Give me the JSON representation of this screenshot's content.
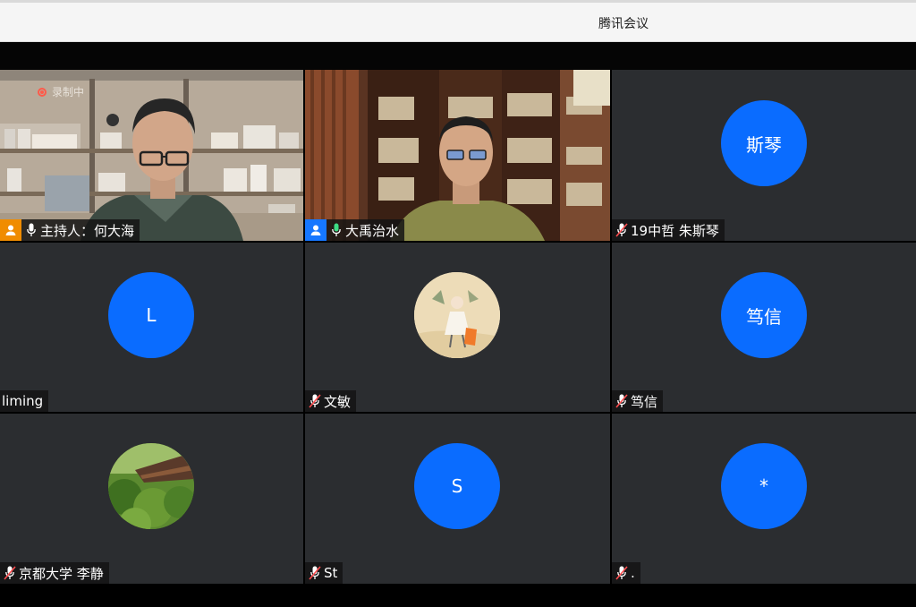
{
  "window": {
    "title": "腾讯会议"
  },
  "recording": {
    "label": "录制中"
  },
  "colors": {
    "avatar_blue": "#0a6cff",
    "host_orange": "#f08c00",
    "cohost_blue": "#1677ff",
    "active_green": "#2ea043"
  },
  "participants": [
    {
      "name": "主持人：何大海",
      "role": "host",
      "mic": "on",
      "video": true
    },
    {
      "name": "大禹治水",
      "role": "cohost",
      "mic": "on",
      "video": true,
      "speaking": true
    },
    {
      "name": "19中哲 朱斯琴",
      "avatar_text": "斯琴",
      "mic": "muted",
      "video": false
    },
    {
      "name": "liming",
      "avatar_text": "L",
      "mic": "none",
      "video": false
    },
    {
      "name": "文敏",
      "avatar_icon": "illustration-avatar-icon",
      "mic": "muted",
      "video": false
    },
    {
      "name": "笃信",
      "avatar_text": "笃信",
      "mic": "muted",
      "video": false
    },
    {
      "name": "京都大学 李静",
      "avatar_icon": "pagoda-photo-avatar-icon",
      "mic": "muted",
      "video": false
    },
    {
      "name": "St",
      "avatar_text": "S",
      "mic": "muted",
      "video": false
    },
    {
      "name": ".",
      "avatar_text": "*",
      "mic": "muted",
      "video": false
    }
  ]
}
